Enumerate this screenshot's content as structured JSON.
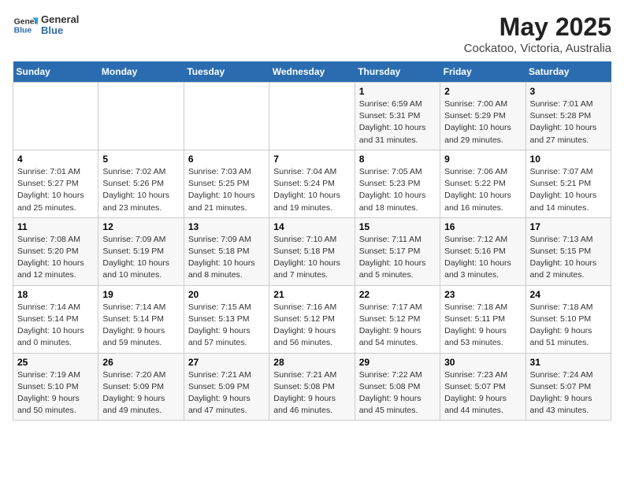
{
  "header": {
    "logo_general": "General",
    "logo_blue": "Blue",
    "month_title": "May 2025",
    "location": "Cockatoo, Victoria, Australia"
  },
  "calendar": {
    "days_of_week": [
      "Sunday",
      "Monday",
      "Tuesday",
      "Wednesday",
      "Thursday",
      "Friday",
      "Saturday"
    ],
    "weeks": [
      [
        {
          "day": "",
          "info": ""
        },
        {
          "day": "",
          "info": ""
        },
        {
          "day": "",
          "info": ""
        },
        {
          "day": "",
          "info": ""
        },
        {
          "day": "1",
          "info": "Sunrise: 6:59 AM\nSunset: 5:31 PM\nDaylight: 10 hours\nand 31 minutes."
        },
        {
          "day": "2",
          "info": "Sunrise: 7:00 AM\nSunset: 5:29 PM\nDaylight: 10 hours\nand 29 minutes."
        },
        {
          "day": "3",
          "info": "Sunrise: 7:01 AM\nSunset: 5:28 PM\nDaylight: 10 hours\nand 27 minutes."
        }
      ],
      [
        {
          "day": "4",
          "info": "Sunrise: 7:01 AM\nSunset: 5:27 PM\nDaylight: 10 hours\nand 25 minutes."
        },
        {
          "day": "5",
          "info": "Sunrise: 7:02 AM\nSunset: 5:26 PM\nDaylight: 10 hours\nand 23 minutes."
        },
        {
          "day": "6",
          "info": "Sunrise: 7:03 AM\nSunset: 5:25 PM\nDaylight: 10 hours\nand 21 minutes."
        },
        {
          "day": "7",
          "info": "Sunrise: 7:04 AM\nSunset: 5:24 PM\nDaylight: 10 hours\nand 19 minutes."
        },
        {
          "day": "8",
          "info": "Sunrise: 7:05 AM\nSunset: 5:23 PM\nDaylight: 10 hours\nand 18 minutes."
        },
        {
          "day": "9",
          "info": "Sunrise: 7:06 AM\nSunset: 5:22 PM\nDaylight: 10 hours\nand 16 minutes."
        },
        {
          "day": "10",
          "info": "Sunrise: 7:07 AM\nSunset: 5:21 PM\nDaylight: 10 hours\nand 14 minutes."
        }
      ],
      [
        {
          "day": "11",
          "info": "Sunrise: 7:08 AM\nSunset: 5:20 PM\nDaylight: 10 hours\nand 12 minutes."
        },
        {
          "day": "12",
          "info": "Sunrise: 7:09 AM\nSunset: 5:19 PM\nDaylight: 10 hours\nand 10 minutes."
        },
        {
          "day": "13",
          "info": "Sunrise: 7:09 AM\nSunset: 5:18 PM\nDaylight: 10 hours\nand 8 minutes."
        },
        {
          "day": "14",
          "info": "Sunrise: 7:10 AM\nSunset: 5:18 PM\nDaylight: 10 hours\nand 7 minutes."
        },
        {
          "day": "15",
          "info": "Sunrise: 7:11 AM\nSunset: 5:17 PM\nDaylight: 10 hours\nand 5 minutes."
        },
        {
          "day": "16",
          "info": "Sunrise: 7:12 AM\nSunset: 5:16 PM\nDaylight: 10 hours\nand 3 minutes."
        },
        {
          "day": "17",
          "info": "Sunrise: 7:13 AM\nSunset: 5:15 PM\nDaylight: 10 hours\nand 2 minutes."
        }
      ],
      [
        {
          "day": "18",
          "info": "Sunrise: 7:14 AM\nSunset: 5:14 PM\nDaylight: 10 hours\nand 0 minutes."
        },
        {
          "day": "19",
          "info": "Sunrise: 7:14 AM\nSunset: 5:14 PM\nDaylight: 9 hours\nand 59 minutes."
        },
        {
          "day": "20",
          "info": "Sunrise: 7:15 AM\nSunset: 5:13 PM\nDaylight: 9 hours\nand 57 minutes."
        },
        {
          "day": "21",
          "info": "Sunrise: 7:16 AM\nSunset: 5:12 PM\nDaylight: 9 hours\nand 56 minutes."
        },
        {
          "day": "22",
          "info": "Sunrise: 7:17 AM\nSunset: 5:12 PM\nDaylight: 9 hours\nand 54 minutes."
        },
        {
          "day": "23",
          "info": "Sunrise: 7:18 AM\nSunset: 5:11 PM\nDaylight: 9 hours\nand 53 minutes."
        },
        {
          "day": "24",
          "info": "Sunrise: 7:18 AM\nSunset: 5:10 PM\nDaylight: 9 hours\nand 51 minutes."
        }
      ],
      [
        {
          "day": "25",
          "info": "Sunrise: 7:19 AM\nSunset: 5:10 PM\nDaylight: 9 hours\nand 50 minutes."
        },
        {
          "day": "26",
          "info": "Sunrise: 7:20 AM\nSunset: 5:09 PM\nDaylight: 9 hours\nand 49 minutes."
        },
        {
          "day": "27",
          "info": "Sunrise: 7:21 AM\nSunset: 5:09 PM\nDaylight: 9 hours\nand 47 minutes."
        },
        {
          "day": "28",
          "info": "Sunrise: 7:21 AM\nSunset: 5:08 PM\nDaylight: 9 hours\nand 46 minutes."
        },
        {
          "day": "29",
          "info": "Sunrise: 7:22 AM\nSunset: 5:08 PM\nDaylight: 9 hours\nand 45 minutes."
        },
        {
          "day": "30",
          "info": "Sunrise: 7:23 AM\nSunset: 5:07 PM\nDaylight: 9 hours\nand 44 minutes."
        },
        {
          "day": "31",
          "info": "Sunrise: 7:24 AM\nSunset: 5:07 PM\nDaylight: 9 hours\nand 43 minutes."
        }
      ]
    ]
  }
}
